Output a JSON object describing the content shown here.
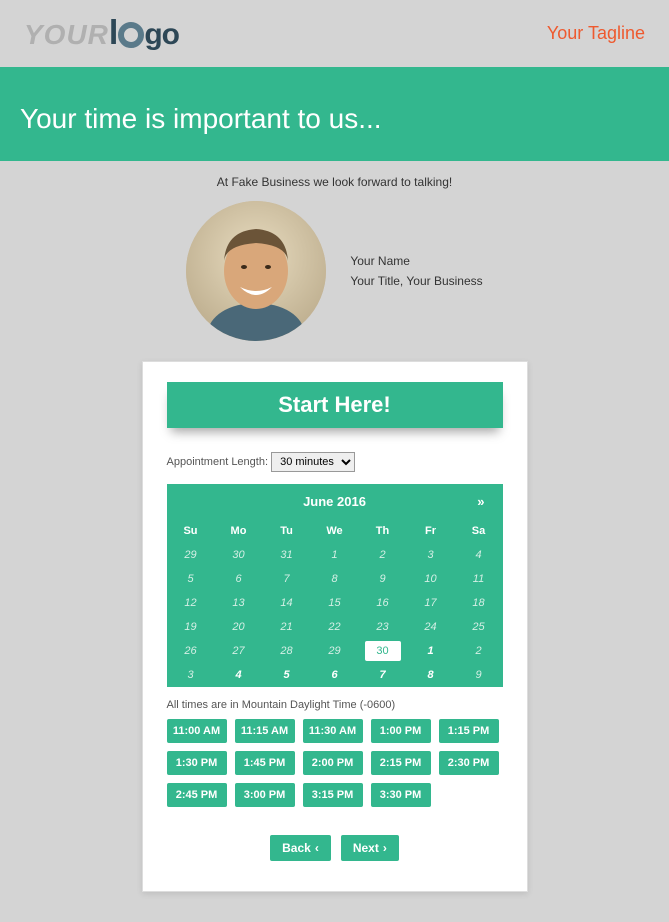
{
  "header": {
    "logo_part1": "YOUR",
    "logo_part2": "l",
    "logo_part3": "go",
    "tagline": "Your Tagline"
  },
  "hero": {
    "title": "Your time is important to us..."
  },
  "intro": "At Fake Business we look forward to talking!",
  "person": {
    "name": "Your Name",
    "title": "Your Title, Your Business"
  },
  "card": {
    "start": "Start Here!",
    "apt_label": "Appointment Length:",
    "apt_value": "30 minutes",
    "tz": "All times are in Mountain Daylight Time (-0600)",
    "back": "Back",
    "next": "Next"
  },
  "calendar": {
    "month": "June 2016",
    "next_arrow": "»",
    "dow": [
      "Su",
      "Mo",
      "Tu",
      "We",
      "Th",
      "Fr",
      "Sa"
    ],
    "days": [
      {
        "n": "29",
        "t": "prev"
      },
      {
        "n": "30",
        "t": "prev"
      },
      {
        "n": "31",
        "t": "prev"
      },
      {
        "n": "1",
        "t": "prev"
      },
      {
        "n": "2",
        "t": "prev"
      },
      {
        "n": "3",
        "t": "prev"
      },
      {
        "n": "4",
        "t": "prev"
      },
      {
        "n": "5",
        "t": "prev"
      },
      {
        "n": "6",
        "t": "prev"
      },
      {
        "n": "7",
        "t": "prev"
      },
      {
        "n": "8",
        "t": "prev"
      },
      {
        "n": "9",
        "t": "prev"
      },
      {
        "n": "10",
        "t": "prev"
      },
      {
        "n": "11",
        "t": "prev"
      },
      {
        "n": "12",
        "t": "prev"
      },
      {
        "n": "13",
        "t": "prev"
      },
      {
        "n": "14",
        "t": "prev"
      },
      {
        "n": "15",
        "t": "prev"
      },
      {
        "n": "16",
        "t": "prev"
      },
      {
        "n": "17",
        "t": "prev"
      },
      {
        "n": "18",
        "t": "prev"
      },
      {
        "n": "19",
        "t": "prev"
      },
      {
        "n": "20",
        "t": "prev"
      },
      {
        "n": "21",
        "t": "prev"
      },
      {
        "n": "22",
        "t": "prev"
      },
      {
        "n": "23",
        "t": "prev"
      },
      {
        "n": "24",
        "t": "prev"
      },
      {
        "n": "25",
        "t": "prev"
      },
      {
        "n": "26",
        "t": "prev"
      },
      {
        "n": "27",
        "t": "prev"
      },
      {
        "n": "28",
        "t": "prev"
      },
      {
        "n": "29",
        "t": "prev"
      },
      {
        "n": "30",
        "t": "sel"
      },
      {
        "n": "1",
        "t": "curr"
      },
      {
        "n": "2",
        "t": "prev"
      },
      {
        "n": "3",
        "t": "prev"
      },
      {
        "n": "4",
        "t": "curr"
      },
      {
        "n": "5",
        "t": "curr"
      },
      {
        "n": "6",
        "t": "curr"
      },
      {
        "n": "7",
        "t": "curr"
      },
      {
        "n": "8",
        "t": "curr"
      },
      {
        "n": "9",
        "t": "prev"
      }
    ]
  },
  "slots": [
    "11:00 AM",
    "11:15 AM",
    "11:30 AM",
    "1:00 PM",
    "1:15 PM",
    "1:30 PM",
    "1:45 PM",
    "2:00 PM",
    "2:15 PM",
    "2:30 PM",
    "2:45 PM",
    "3:00 PM",
    "3:15 PM",
    "3:30 PM"
  ]
}
